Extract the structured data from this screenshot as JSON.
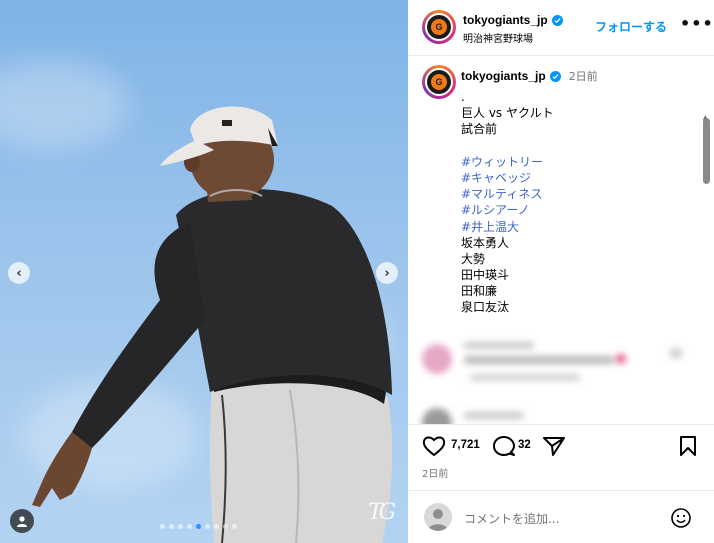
{
  "post": {
    "username": "tokyogiants_jp",
    "location": "明治神宮野球場",
    "follow_label": "フォローする",
    "more_label": "•••",
    "avatar_letter": "G"
  },
  "caption": {
    "username": "tokyogiants_jp",
    "time": "2日前",
    "lines": [
      ".",
      "巨人 vs ヤクルト",
      "試合前",
      "",
      "#ウィットリー",
      "#キャベッジ",
      "#マルティネス",
      "#ルシアーノ",
      "#井上温大",
      "坂本勇人",
      "大勢",
      "田中瑛斗",
      "田和廉",
      "泉口友汰"
    ]
  },
  "actions": {
    "likes": "7,721",
    "comments": "32",
    "date": "2日前"
  },
  "comment_box": {
    "placeholder": "コメントを追加..."
  },
  "photo": {
    "prev_label": "‹",
    "next_label": "›",
    "watermark": "TG",
    "dot_count": 9,
    "active_dot": 4
  },
  "colors": {
    "link_blue": "#0095f6",
    "hashtag": "#3d65c9",
    "sky": "#8fbbe9",
    "brand_orange": "#f07b16"
  }
}
